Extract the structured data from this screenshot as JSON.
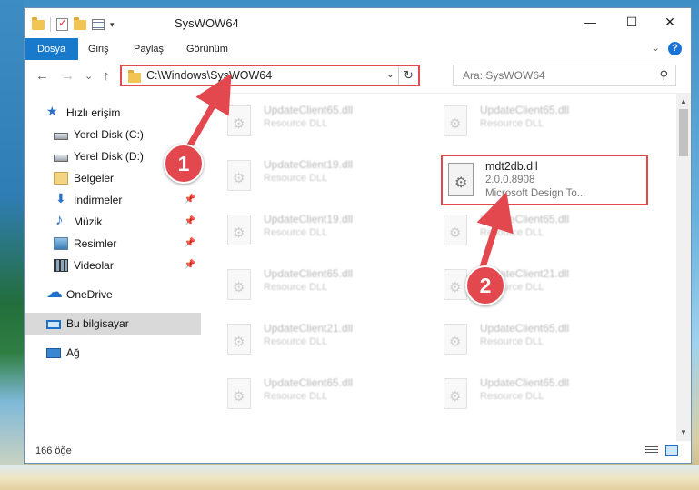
{
  "window": {
    "title": "SysWOW64",
    "minimize_glyph": "—",
    "maximize_glyph": "☐",
    "close_glyph": "✕"
  },
  "ribbon": {
    "tabs": [
      "Dosya",
      "Giriş",
      "Paylaş",
      "Görünüm"
    ],
    "active_tab": "Dosya",
    "collapse_glyph": "⌄",
    "help_glyph": "?"
  },
  "navbar": {
    "back_glyph": "←",
    "forward_glyph": "→",
    "recent_glyph": "⌄",
    "up_glyph": "↑",
    "address": "C:\\Windows\\SysWOW64",
    "address_dropdown_glyph": "⌄",
    "refresh_glyph": "↻",
    "search_placeholder": "Ara: SysWOW64",
    "search_glyph": "⚲"
  },
  "sidebar": {
    "items": [
      {
        "label": "Hızlı erişim",
        "icon": "star-icon"
      },
      {
        "label": "Yerel Disk (C:)",
        "icon": "disk-icon"
      },
      {
        "label": "Yerel Disk (D:)",
        "icon": "disk-icon"
      },
      {
        "label": "Belgeler",
        "icon": "documents-icon",
        "pinned": true
      },
      {
        "label": "İndirmeler",
        "icon": "downloads-icon",
        "pinned": true
      },
      {
        "label": "Müzik",
        "icon": "music-icon",
        "pinned": true
      },
      {
        "label": "Resimler",
        "icon": "pictures-icon",
        "pinned": true
      },
      {
        "label": "Videolar",
        "icon": "videos-icon",
        "pinned": true
      },
      {
        "label": "OneDrive",
        "icon": "onedrive-icon"
      },
      {
        "label": "Bu bilgisayar",
        "icon": "this-pc-icon",
        "selected": true
      },
      {
        "label": "Ağ",
        "icon": "network-icon"
      }
    ],
    "pin_glyph": "📌"
  },
  "files": {
    "left_column": [
      {
        "name": "UpdateClient65.dll",
        "type": "Resource DLL"
      },
      {
        "name": "UpdateClient19.dll",
        "type": "Resource DLL"
      },
      {
        "name": "UpdateClient19.dll",
        "type": "Resource DLL"
      },
      {
        "name": "UpdateClient65.dll",
        "type": "Resource DLL"
      },
      {
        "name": "UpdateClient21.dll",
        "type": "Resource DLL"
      },
      {
        "name": "UpdateClient65.dll",
        "type": "Resource DLL"
      }
    ],
    "right_column": [
      {
        "name": "UpdateClient65.dll",
        "type": "Resource DLL"
      },
      {
        "name": "UpdateClient65.dll",
        "type": "Resource DLL"
      },
      {
        "name": "UpdateClient21.dll",
        "type": "Resource DLL"
      },
      {
        "name": "UpdateClient65.dll",
        "type": "Resource DLL"
      },
      {
        "name": "UpdateClient65.dll",
        "type": "Resource DLL"
      }
    ],
    "highlighted": {
      "name": "mdt2db.dll",
      "version": "2.0.0.8908",
      "description": "Microsoft Design To..."
    }
  },
  "scrollbar": {
    "up_glyph": "▲",
    "down_glyph": "▼"
  },
  "status": {
    "item_count": "166 öğe"
  },
  "annotations": {
    "step1": "1",
    "step2": "2",
    "color": "#e2484d"
  }
}
